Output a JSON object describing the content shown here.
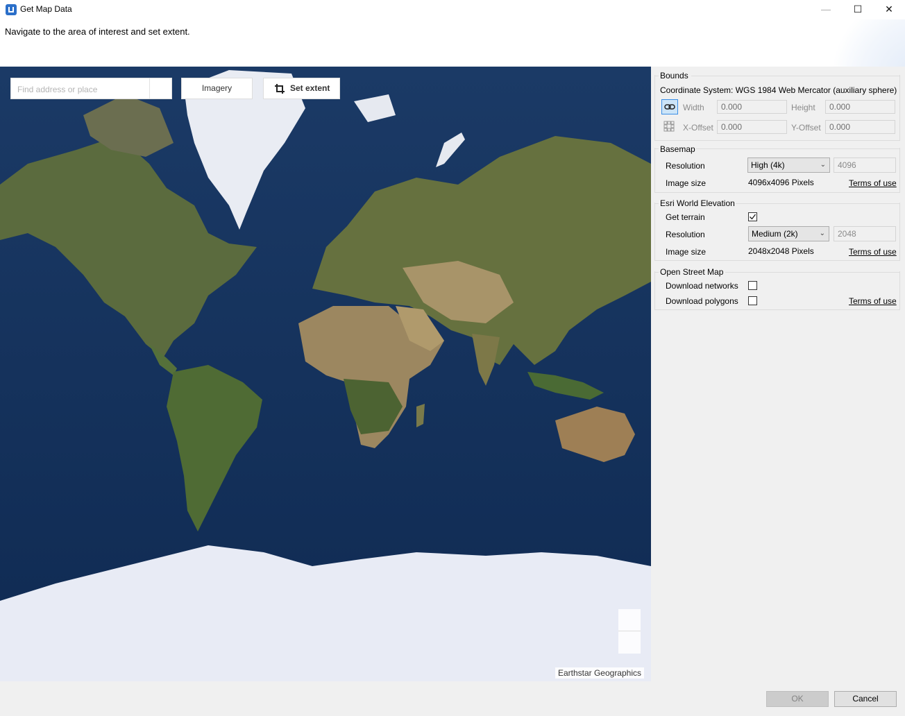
{
  "window": {
    "title": "Get Map Data",
    "minimize": "—",
    "maximize": "☐",
    "close": "✕"
  },
  "header": {
    "instruction": "Navigate to the area of interest and set extent."
  },
  "map": {
    "search_placeholder": "Find address or place",
    "imagery_label": "Imagery",
    "set_extent_label": "Set extent",
    "attribution": "Earthstar Geographics"
  },
  "bounds": {
    "title": "Bounds",
    "coordinate_system": "Coordinate System: WGS 1984 Web Mercator (auxiliary sphere)",
    "width_label": "Width",
    "width_value": "0.000",
    "height_label": "Height",
    "height_value": "0.000",
    "xoffset_label": "X-Offset",
    "xoffset_value": "0.000",
    "yoffset_label": "Y-Offset",
    "yoffset_value": "0.000"
  },
  "basemap": {
    "title": "Basemap",
    "resolution_label": "Resolution",
    "resolution_value": "High (4k)",
    "resolution_pixels": "4096",
    "image_size_label": "Image size",
    "image_size_value": "4096x4096 Pixels",
    "terms": "Terms of use"
  },
  "elevation": {
    "title": "Esri World Elevation",
    "get_terrain_label": "Get terrain",
    "get_terrain_checked": true,
    "resolution_label": "Resolution",
    "resolution_value": "Medium (2k)",
    "resolution_pixels": "2048",
    "image_size_label": "Image size",
    "image_size_value": "2048x2048 Pixels",
    "terms": "Terms of use"
  },
  "osm": {
    "title": "Open Street Map",
    "download_networks_label": "Download networks",
    "download_networks_checked": false,
    "download_polygons_label": "Download polygons",
    "download_polygons_checked": false,
    "terms": "Terms of use"
  },
  "footer": {
    "ok": "OK",
    "cancel": "Cancel"
  },
  "colors": {
    "ocean": "#12305a",
    "land": "#5d6f3c",
    "desert": "#a08a62",
    "ice": "#e8ebf5"
  }
}
